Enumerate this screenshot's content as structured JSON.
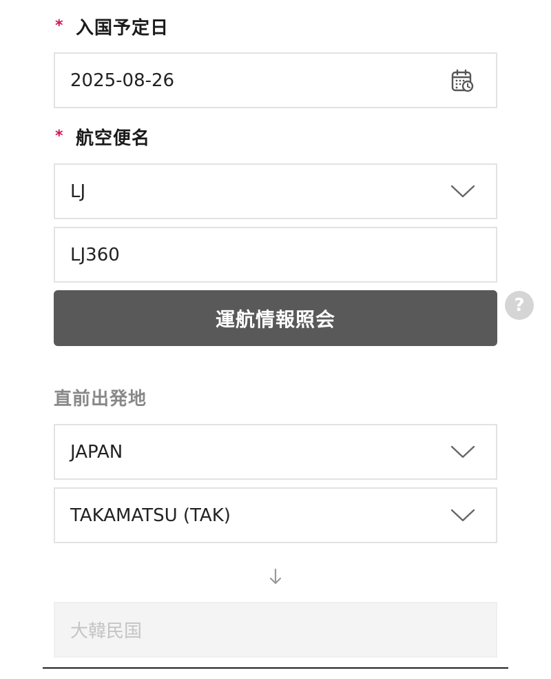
{
  "entry_date": {
    "label": "入国予定日",
    "required_mark": "*",
    "value": "2025-08-26",
    "icon": "calendar-clock-icon"
  },
  "flight": {
    "label": "航空便名",
    "required_mark": "*",
    "airline_value": "LJ",
    "flight_number_value": "LJ360",
    "lookup_button_label": "運航情報照会",
    "help_label": "?"
  },
  "departure": {
    "label": "直前出発地",
    "country_value": "JAPAN",
    "city_value": "TAKAMATSU (TAK)",
    "destination_value": "大韓民国"
  },
  "colors": {
    "required": "#d4145a",
    "button_bg": "#595959",
    "border": "#e2e2e2",
    "disabled_bg": "#f4f4f4"
  }
}
